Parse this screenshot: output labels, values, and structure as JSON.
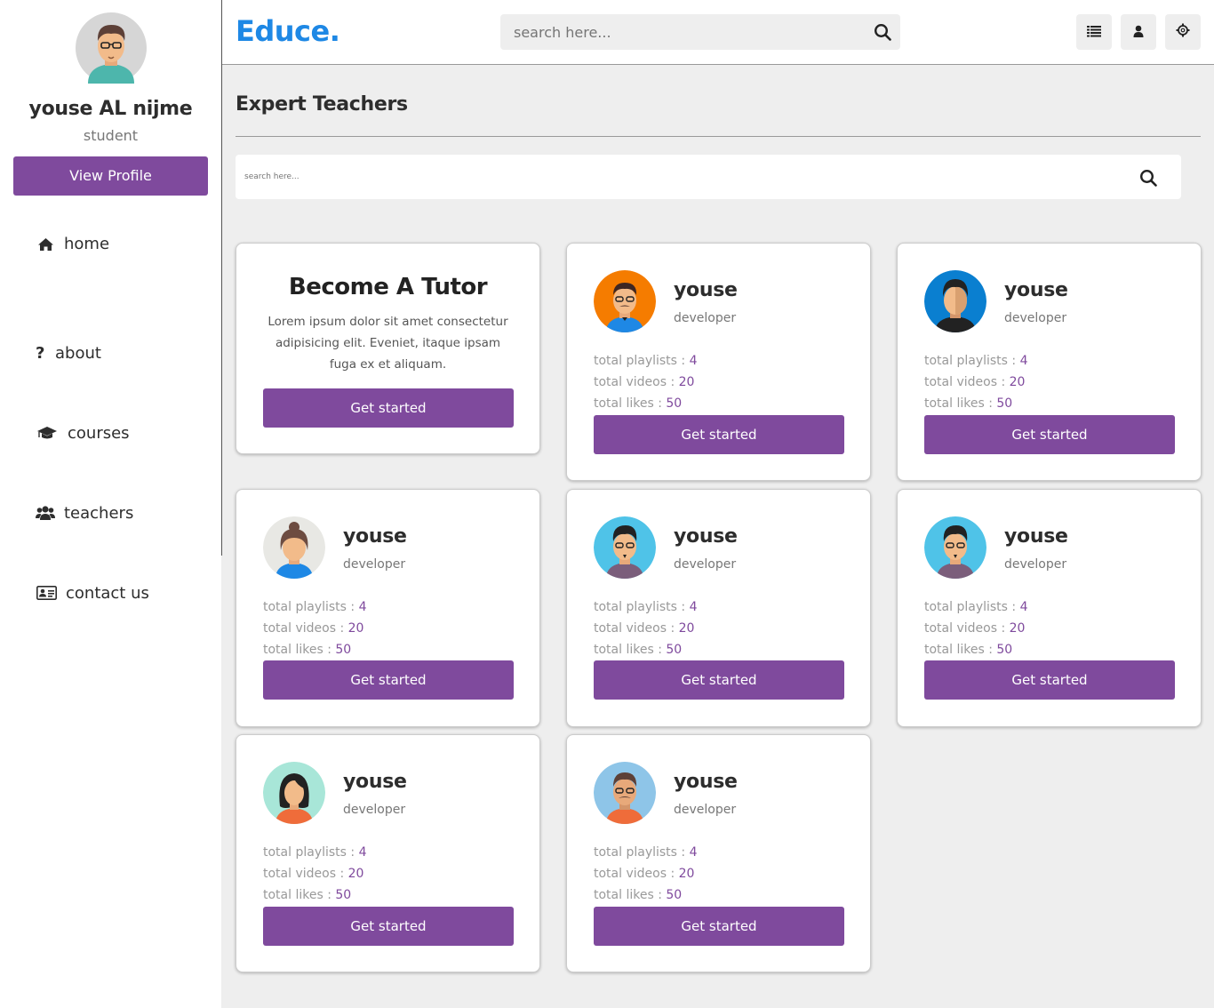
{
  "sidebar": {
    "user_name": "youse AL nijme",
    "user_role": "student",
    "view_profile_label": "View Profile",
    "nav": [
      {
        "label": "home",
        "icon": "home-icon"
      },
      {
        "label": "about",
        "icon": "question-icon"
      },
      {
        "label": "courses",
        "icon": "graduation-cap-icon"
      },
      {
        "label": "teachers",
        "icon": "users-icon"
      },
      {
        "label": "contact us",
        "icon": "address-card-icon"
      }
    ]
  },
  "header": {
    "logo": "Educe.",
    "search_placeholder": "search here...",
    "buttons": [
      "menu-icon",
      "user-icon",
      "settings-icon"
    ]
  },
  "main": {
    "title": "Expert Teachers",
    "search_placeholder": "search here...",
    "tutor_card": {
      "title": "Become A Tutor",
      "text": "Lorem ipsum dolor sit amet consectetur adipisicing elit. Eveniet, itaque ipsam fuga ex et aliquam.",
      "button": "Get started"
    },
    "teachers": [
      {
        "name": "youse",
        "role": "developer",
        "playlists_label": "total playlists",
        "playlists": "4",
        "videos_label": "total videos",
        "videos": "20",
        "likes_label": "total likes",
        "likes": "50",
        "button": "Get started",
        "avatar_bg": "#f57c00"
      },
      {
        "name": "youse",
        "role": "developer",
        "playlists_label": "total playlists",
        "playlists": "4",
        "videos_label": "total videos",
        "videos": "20",
        "likes_label": "total likes",
        "likes": "50",
        "button": "Get started",
        "avatar_bg": "#0a7fd0"
      },
      {
        "name": "youse",
        "role": "developer",
        "playlists_label": "total playlists",
        "playlists": "4",
        "videos_label": "total videos",
        "videos": "20",
        "likes_label": "total likes",
        "likes": "50",
        "button": "Get started",
        "avatar_bg": "#e8e8e4"
      },
      {
        "name": "youse",
        "role": "developer",
        "playlists_label": "total playlists",
        "playlists": "4",
        "videos_label": "total videos",
        "videos": "20",
        "likes_label": "total likes",
        "likes": "50",
        "button": "Get started",
        "avatar_bg": "#4fc3e8"
      },
      {
        "name": "youse",
        "role": "developer",
        "playlists_label": "total playlists",
        "playlists": "4",
        "videos_label": "total videos",
        "videos": "20",
        "likes_label": "total likes",
        "likes": "50",
        "button": "Get started",
        "avatar_bg": "#4fc3e8"
      },
      {
        "name": "youse",
        "role": "developer",
        "playlists_label": "total playlists",
        "playlists": "4",
        "videos_label": "total videos",
        "videos": "20",
        "likes_label": "total likes",
        "likes": "50",
        "button": "Get started",
        "avatar_bg": "#a8e6d8"
      },
      {
        "name": "youse",
        "role": "developer",
        "playlists_label": "total playlists",
        "playlists": "4",
        "videos_label": "total videos",
        "videos": "20",
        "likes_label": "total likes",
        "likes": "50",
        "button": "Get started",
        "avatar_bg": "#8ec5e8"
      }
    ]
  },
  "colors": {
    "accent": "#7f4a9d",
    "logo": "#1e88e5"
  }
}
